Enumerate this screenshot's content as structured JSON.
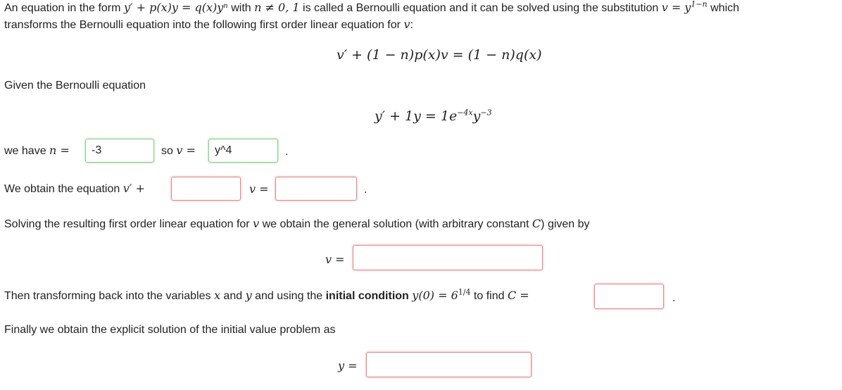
{
  "intro": {
    "p1": "An equation in the form",
    "eq_form": "y′ + p(x)y = q(x)yⁿ",
    "p2": "with",
    "cond": "n ≠ 0, 1",
    "p3": "is called a Bernoulli equation and it can be solved using the substitution",
    "subst": "v = y",
    "subst_exp": "1−n",
    "p4": "which",
    "line2a": "transforms the Bernoulli equation into the following first order linear equation for",
    "line2b": "v",
    "line2c": ":"
  },
  "linear_eq": "v′ + (1 − n)p(x)v = (1 − n)q(x)",
  "given_label": "Given the Bernoulli equation",
  "given_eq": {
    "lhs": "y′ + 1y = 1e",
    "exp1": "−4x",
    "mid": "y",
    "exp2": "−3"
  },
  "have_n": {
    "label": "we have",
    "var": "n =",
    "value": "-3",
    "so": "so",
    "v": "v =",
    "v_value": "y^4",
    "dot": "."
  },
  "obtain": {
    "label": "We obtain the equation",
    "vprime": "v′ +",
    "v": "v =",
    "dot": ".",
    "value1": "",
    "value2": ""
  },
  "solving": {
    "a": "Solving the resulting first order linear equation for",
    "v": "v",
    "b": "we obtain the general solution (with arbitrary constant",
    "C": "C",
    "c": ") given by"
  },
  "general": {
    "v": "v =",
    "value": ""
  },
  "then": {
    "a": "Then transforming back into the variables",
    "x": "x",
    "and": "and",
    "y": "y",
    "b": "and using the",
    "bold": "initial condition",
    "ic": "y(0) = 6",
    "ic_exp": "1/4",
    "c": "to find",
    "C": "C =",
    "value": "",
    "dot": "."
  },
  "finally": "Finally we obtain the explicit solution of the initial value problem as",
  "explicit": {
    "y": "y =",
    "value": ""
  }
}
